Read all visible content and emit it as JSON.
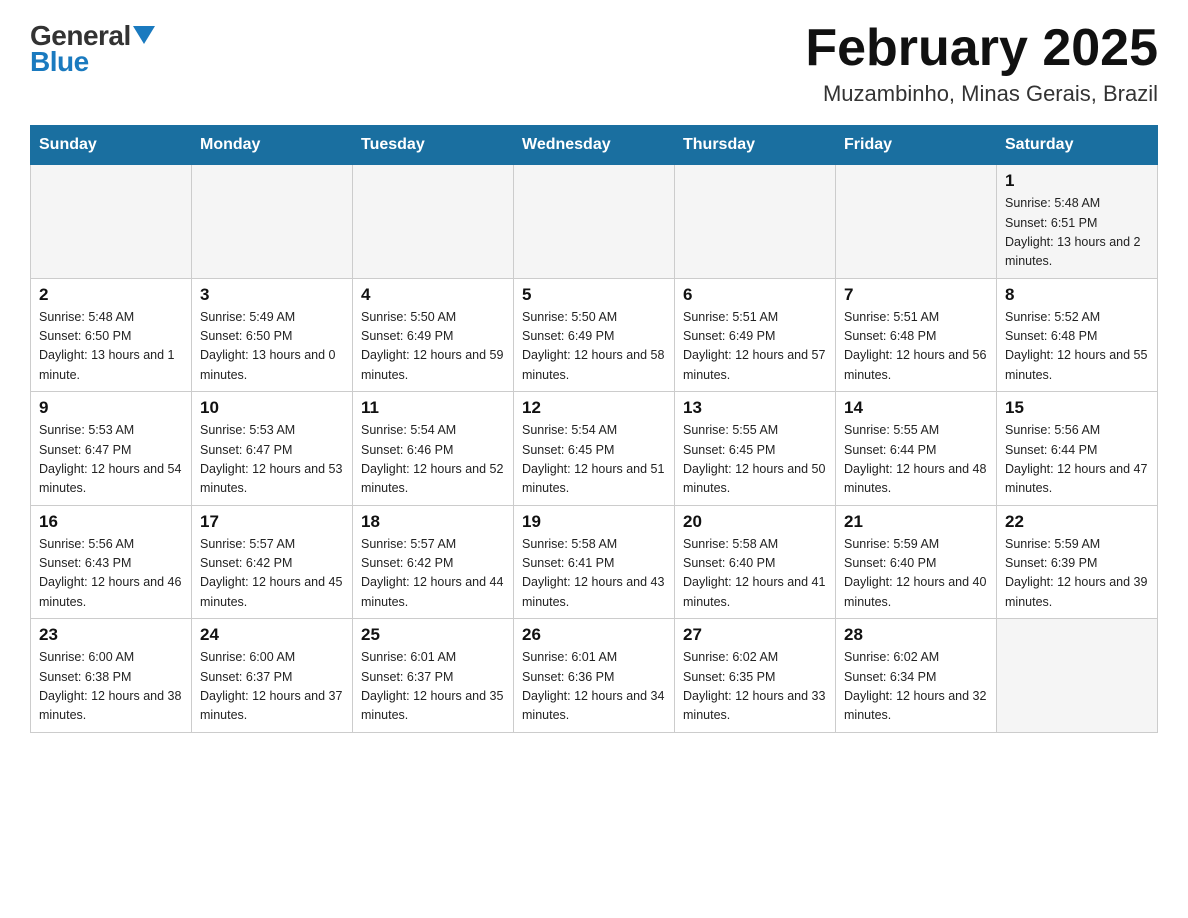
{
  "header": {
    "logo_general": "General",
    "logo_blue": "Blue",
    "title": "February 2025",
    "subtitle": "Muzambinho, Minas Gerais, Brazil"
  },
  "days_of_week": [
    "Sunday",
    "Monday",
    "Tuesday",
    "Wednesday",
    "Thursday",
    "Friday",
    "Saturday"
  ],
  "weeks": [
    {
      "cells": [
        {
          "day": null
        },
        {
          "day": null
        },
        {
          "day": null
        },
        {
          "day": null
        },
        {
          "day": null
        },
        {
          "day": null
        },
        {
          "day": "1",
          "sunrise": "Sunrise: 5:48 AM",
          "sunset": "Sunset: 6:51 PM",
          "daylight": "Daylight: 13 hours and 2 minutes."
        }
      ]
    },
    {
      "cells": [
        {
          "day": "2",
          "sunrise": "Sunrise: 5:48 AM",
          "sunset": "Sunset: 6:50 PM",
          "daylight": "Daylight: 13 hours and 1 minute."
        },
        {
          "day": "3",
          "sunrise": "Sunrise: 5:49 AM",
          "sunset": "Sunset: 6:50 PM",
          "daylight": "Daylight: 13 hours and 0 minutes."
        },
        {
          "day": "4",
          "sunrise": "Sunrise: 5:50 AM",
          "sunset": "Sunset: 6:49 PM",
          "daylight": "Daylight: 12 hours and 59 minutes."
        },
        {
          "day": "5",
          "sunrise": "Sunrise: 5:50 AM",
          "sunset": "Sunset: 6:49 PM",
          "daylight": "Daylight: 12 hours and 58 minutes."
        },
        {
          "day": "6",
          "sunrise": "Sunrise: 5:51 AM",
          "sunset": "Sunset: 6:49 PM",
          "daylight": "Daylight: 12 hours and 57 minutes."
        },
        {
          "day": "7",
          "sunrise": "Sunrise: 5:51 AM",
          "sunset": "Sunset: 6:48 PM",
          "daylight": "Daylight: 12 hours and 56 minutes."
        },
        {
          "day": "8",
          "sunrise": "Sunrise: 5:52 AM",
          "sunset": "Sunset: 6:48 PM",
          "daylight": "Daylight: 12 hours and 55 minutes."
        }
      ]
    },
    {
      "cells": [
        {
          "day": "9",
          "sunrise": "Sunrise: 5:53 AM",
          "sunset": "Sunset: 6:47 PM",
          "daylight": "Daylight: 12 hours and 54 minutes."
        },
        {
          "day": "10",
          "sunrise": "Sunrise: 5:53 AM",
          "sunset": "Sunset: 6:47 PM",
          "daylight": "Daylight: 12 hours and 53 minutes."
        },
        {
          "day": "11",
          "sunrise": "Sunrise: 5:54 AM",
          "sunset": "Sunset: 6:46 PM",
          "daylight": "Daylight: 12 hours and 52 minutes."
        },
        {
          "day": "12",
          "sunrise": "Sunrise: 5:54 AM",
          "sunset": "Sunset: 6:45 PM",
          "daylight": "Daylight: 12 hours and 51 minutes."
        },
        {
          "day": "13",
          "sunrise": "Sunrise: 5:55 AM",
          "sunset": "Sunset: 6:45 PM",
          "daylight": "Daylight: 12 hours and 50 minutes."
        },
        {
          "day": "14",
          "sunrise": "Sunrise: 5:55 AM",
          "sunset": "Sunset: 6:44 PM",
          "daylight": "Daylight: 12 hours and 48 minutes."
        },
        {
          "day": "15",
          "sunrise": "Sunrise: 5:56 AM",
          "sunset": "Sunset: 6:44 PM",
          "daylight": "Daylight: 12 hours and 47 minutes."
        }
      ]
    },
    {
      "cells": [
        {
          "day": "16",
          "sunrise": "Sunrise: 5:56 AM",
          "sunset": "Sunset: 6:43 PM",
          "daylight": "Daylight: 12 hours and 46 minutes."
        },
        {
          "day": "17",
          "sunrise": "Sunrise: 5:57 AM",
          "sunset": "Sunset: 6:42 PM",
          "daylight": "Daylight: 12 hours and 45 minutes."
        },
        {
          "day": "18",
          "sunrise": "Sunrise: 5:57 AM",
          "sunset": "Sunset: 6:42 PM",
          "daylight": "Daylight: 12 hours and 44 minutes."
        },
        {
          "day": "19",
          "sunrise": "Sunrise: 5:58 AM",
          "sunset": "Sunset: 6:41 PM",
          "daylight": "Daylight: 12 hours and 43 minutes."
        },
        {
          "day": "20",
          "sunrise": "Sunrise: 5:58 AM",
          "sunset": "Sunset: 6:40 PM",
          "daylight": "Daylight: 12 hours and 41 minutes."
        },
        {
          "day": "21",
          "sunrise": "Sunrise: 5:59 AM",
          "sunset": "Sunset: 6:40 PM",
          "daylight": "Daylight: 12 hours and 40 minutes."
        },
        {
          "day": "22",
          "sunrise": "Sunrise: 5:59 AM",
          "sunset": "Sunset: 6:39 PM",
          "daylight": "Daylight: 12 hours and 39 minutes."
        }
      ]
    },
    {
      "cells": [
        {
          "day": "23",
          "sunrise": "Sunrise: 6:00 AM",
          "sunset": "Sunset: 6:38 PM",
          "daylight": "Daylight: 12 hours and 38 minutes."
        },
        {
          "day": "24",
          "sunrise": "Sunrise: 6:00 AM",
          "sunset": "Sunset: 6:37 PM",
          "daylight": "Daylight: 12 hours and 37 minutes."
        },
        {
          "day": "25",
          "sunrise": "Sunrise: 6:01 AM",
          "sunset": "Sunset: 6:37 PM",
          "daylight": "Daylight: 12 hours and 35 minutes."
        },
        {
          "day": "26",
          "sunrise": "Sunrise: 6:01 AM",
          "sunset": "Sunset: 6:36 PM",
          "daylight": "Daylight: 12 hours and 34 minutes."
        },
        {
          "day": "27",
          "sunrise": "Sunrise: 6:02 AM",
          "sunset": "Sunset: 6:35 PM",
          "daylight": "Daylight: 12 hours and 33 minutes."
        },
        {
          "day": "28",
          "sunrise": "Sunrise: 6:02 AM",
          "sunset": "Sunset: 6:34 PM",
          "daylight": "Daylight: 12 hours and 32 minutes."
        },
        {
          "day": null
        }
      ]
    }
  ]
}
